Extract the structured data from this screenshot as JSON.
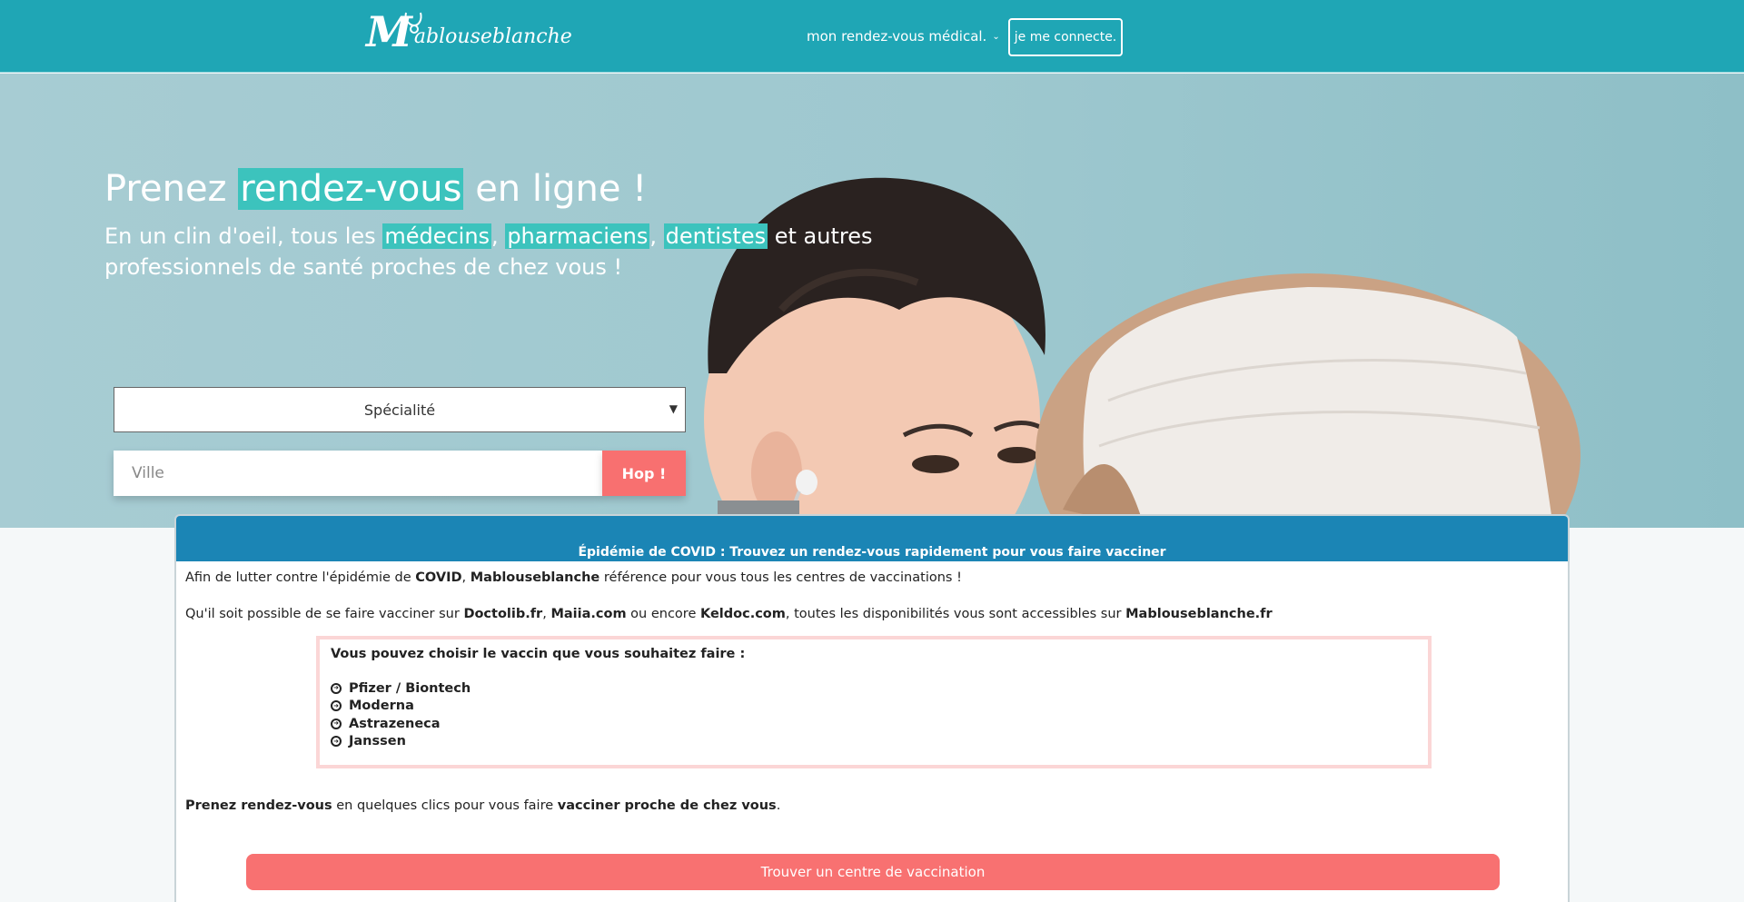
{
  "header": {
    "logo_m": "M",
    "logo_rest": "ablouseblanche",
    "nav_medical": "mon rendez-vous médical.",
    "login_button": "je me connecte."
  },
  "hero": {
    "title_a": "Prenez ",
    "title_hl": "rendez-vous",
    "title_b": " en ligne !",
    "sub_a": "En un clin d'oeil, tous les ",
    "sub_hl1": "médecins",
    "sub_c1": ", ",
    "sub_hl2": "pharmaciens",
    "sub_c2": ", ",
    "sub_hl3": "dentistes",
    "sub_b": " et autres professionnels de santé proches de chez vous !",
    "specialty_selected": "Spécialité",
    "city_placeholder": "Ville",
    "search_button": "Hop !"
  },
  "covid": {
    "heading": "Épidémie de COVID : Trouvez un rendez-vous rapidement pour vous faire vacciner",
    "p1_a": "Afin de lutter contre l'épidémie de ",
    "p1_b": "COVID",
    "p1_c": ", ",
    "p1_d": "Mablouseblanche",
    "p1_e": " référence pour vous tous les centres de vaccinations !",
    "p2_a": "Qu'il soit possible de se faire vacciner sur ",
    "p2_b": "Doctolib.fr",
    "p2_c": ", ",
    "p2_d": "Maiia.com",
    "p2_e": " ou encore ",
    "p2_f": "Keldoc.com",
    "p2_g": ", toutes les disponibilités vous sont accessibles sur ",
    "p2_h": "Mablouseblanche.fr",
    "vaccine_box_title": "Vous pouvez choisir le vaccin que vous souhaitez faire :",
    "vaccines": [
      "Pfizer / Biontech",
      "Moderna",
      "Astrazeneca",
      "Janssen"
    ],
    "p3_a": "Prenez rendez-vous",
    "p3_b": " en quelques clics pour vous faire ",
    "p3_c": "vacciner proche de chez vous",
    "p3_d": ".",
    "find_button": "Trouver un centre de vaccination"
  },
  "colors": {
    "header_bg": "#1fa6b5",
    "highlight": "#3cc3bd",
    "accent_red": "#f87070",
    "covid_head": "#1b85b5",
    "vaccine_border": "#fbd6d6"
  }
}
